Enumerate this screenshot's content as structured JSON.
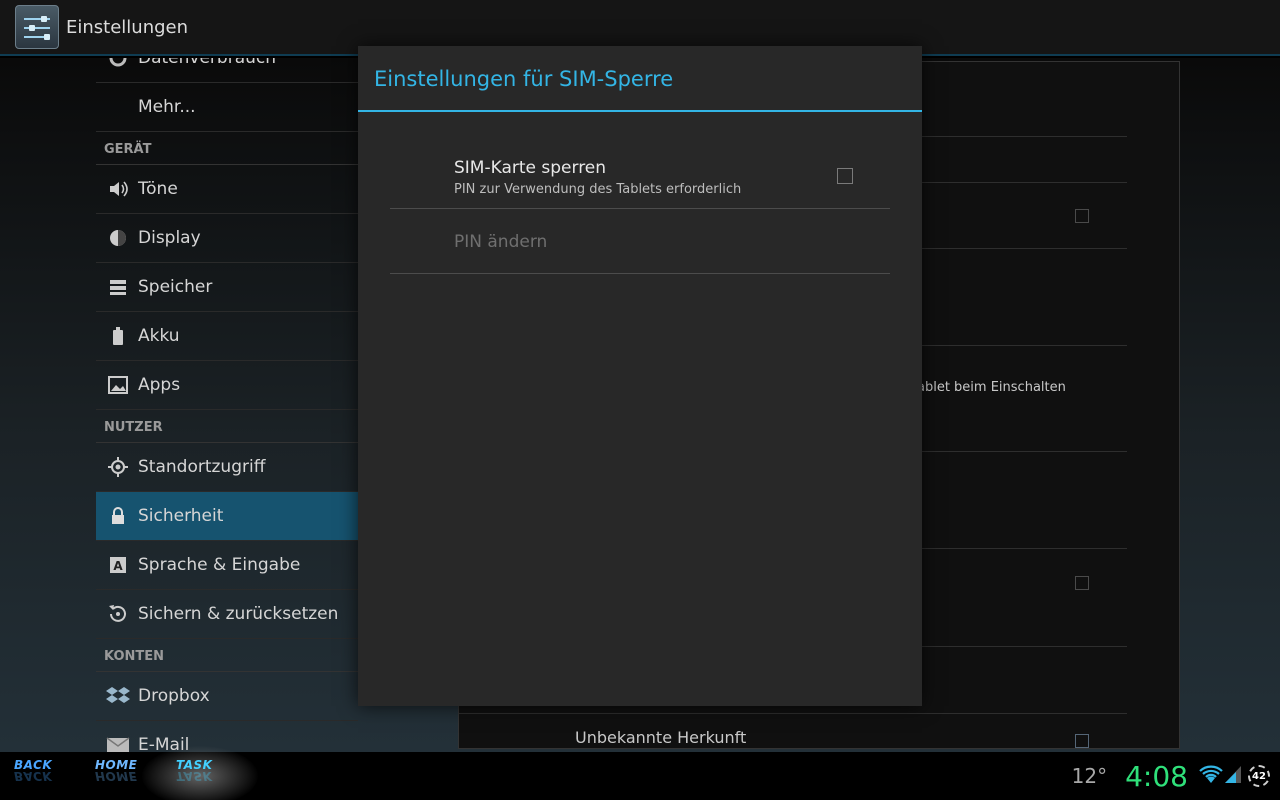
{
  "action_bar": {
    "title": "Einstellungen"
  },
  "sidebar": {
    "items": [
      {
        "label": "Datenverbrauch",
        "icon": "data-usage-icon"
      },
      {
        "label": "Mehr..."
      }
    ],
    "sections": [
      {
        "header": "GERÄT",
        "items": [
          {
            "label": "Töne",
            "icon": "volume-icon"
          },
          {
            "label": "Display",
            "icon": "brightness-icon"
          },
          {
            "label": "Speicher",
            "icon": "storage-icon"
          },
          {
            "label": "Akku",
            "icon": "battery-icon"
          },
          {
            "label": "Apps",
            "icon": "apps-icon"
          }
        ]
      },
      {
        "header": "NUTZER",
        "items": [
          {
            "label": "Standortzugriff",
            "icon": "location-icon"
          },
          {
            "label": "Sicherheit",
            "icon": "lock-icon",
            "active": true
          },
          {
            "label": "Sprache & Eingabe",
            "icon": "keyboard-icon"
          },
          {
            "label": "Sichern & zurücksetzen",
            "icon": "backup-icon"
          }
        ]
      },
      {
        "header": "KONTEN",
        "items": [
          {
            "label": "Dropbox",
            "icon": "dropbox-icon"
          },
          {
            "label": "E-Mail",
            "icon": "email-icon"
          }
        ]
      }
    ]
  },
  "detail": {
    "partial_text": "ablet beim Einschalten",
    "unknown_sources": "Unbekannte Herkunft"
  },
  "dialog": {
    "title": "Einstellungen für SIM-Sperre",
    "lock_sim": {
      "title": "SIM-Karte sperren",
      "summary": "PIN zur Verwendung des Tablets erforderlich",
      "checked": false
    },
    "change_pin": {
      "title": "PIN ändern",
      "enabled": false
    }
  },
  "navbar": {
    "back": "BACK",
    "home": "HOME",
    "task": "TASK"
  },
  "status": {
    "temperature": "12°",
    "time": "4:08",
    "notification_count": "42"
  },
  "colors": {
    "accent": "#33b5e5",
    "selected_item": "#16536f",
    "clock": "#2fe07a",
    "nav_back": "#4aa6ff",
    "nav_home": "#6fb8ff",
    "nav_task": "#43d0ff"
  }
}
